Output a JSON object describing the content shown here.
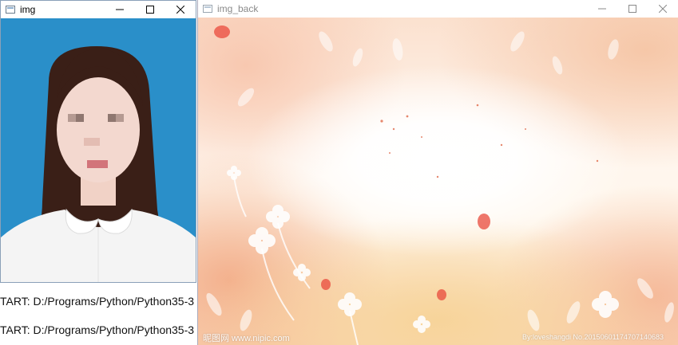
{
  "windows": {
    "img": {
      "title": "img"
    },
    "img_back": {
      "title": "img_back"
    }
  },
  "console": {
    "lines": [
      "TART: D:/Programs/Python/Python35-3",
      "TART: D:/Programs/Python/Python35-3"
    ]
  },
  "watermarks": {
    "left": "昵图网 www.nipic.com",
    "right": "By:loveshangdi No.20150601174707140683"
  },
  "colors": {
    "photo_background": "#2a8fc9",
    "hair": "#3a1f17",
    "shirt": "#f4f4f4"
  },
  "icons": {
    "window_controls": [
      "minimize-icon",
      "maximize-icon",
      "close-icon"
    ],
    "app_icon": "image-window-icon"
  }
}
